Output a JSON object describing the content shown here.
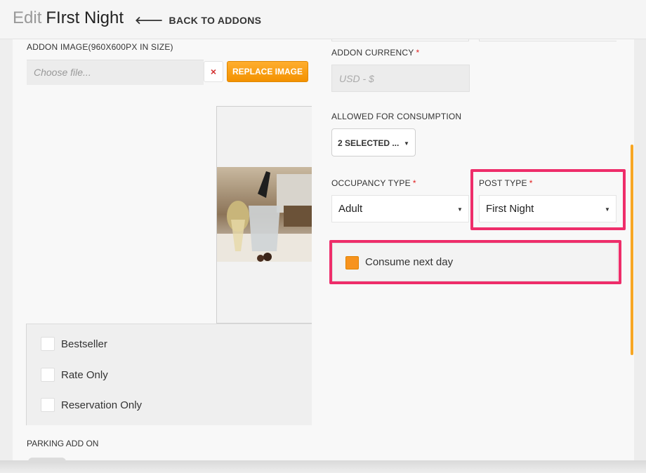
{
  "header": {
    "title_prefix": "Edit",
    "title_name": "FIrst Night",
    "back_label": "BACK TO ADDONS"
  },
  "image_section": {
    "label": "ADDON IMAGE(960X600PX IN SIZE)",
    "file_placeholder": "Choose file...",
    "clear_icon": "×",
    "replace_label": "REPLACE IMAGE"
  },
  "flags": [
    {
      "label": "Bestseller",
      "checked": false
    },
    {
      "label": "Rate Only",
      "checked": false
    },
    {
      "label": "Reservation Only",
      "checked": false
    }
  ],
  "parking": {
    "label": "PARKING ADD ON"
  },
  "currency": {
    "label": "ADDON CURRENCY",
    "required_mark": "*",
    "placeholder": "USD - $"
  },
  "consumption": {
    "label": "ALLOWED FOR CONSUMPTION",
    "value": "2 SELECTED ..."
  },
  "occupancy": {
    "label": "OCCUPANCY TYPE",
    "required_mark": "*",
    "value": "Adult"
  },
  "post_type": {
    "label": "POST TYPE",
    "required_mark": "*",
    "value": "First Night"
  },
  "consume_next_day": {
    "label": "Consume next day",
    "checked": true
  },
  "icons": {
    "back": "arrow-left-icon",
    "clear": "close-icon",
    "caret": "caret-down-icon"
  },
  "colors": {
    "accent": "#f7931e",
    "highlight": "#ee2d6a",
    "required": "#e02020"
  }
}
